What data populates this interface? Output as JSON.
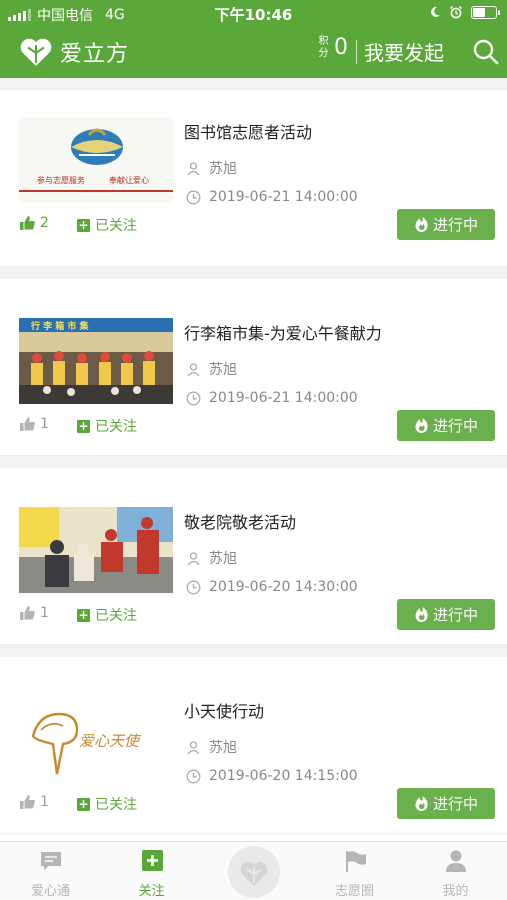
{
  "status_bar": {
    "carrier": "中国电信",
    "network": "4G",
    "time": "下午10:46"
  },
  "header": {
    "app_title": "爱立方",
    "points_label": "积分",
    "points_value": "0",
    "launch_label": "我要发起"
  },
  "activities": [
    {
      "title": "图书馆志愿者活动",
      "author": "苏旭",
      "datetime": "2019-06-21 14:00:00",
      "likes": "2",
      "liked": true,
      "follow_label": "已关注",
      "status": "进行中",
      "image_caption_left": "参与志愿服务",
      "image_caption_right": "奉献让爱心"
    },
    {
      "title": "行李箱市集-为爱心午餐献力",
      "author": "苏旭",
      "datetime": "2019-06-21 14:00:00",
      "likes": "1",
      "liked": false,
      "follow_label": "已关注",
      "status": "进行中",
      "image_banner": "行 李 箱 市 集"
    },
    {
      "title": "敬老院敬老活动",
      "author": "苏旭",
      "datetime": "2019-06-20 14:30:00",
      "likes": "1",
      "liked": false,
      "follow_label": "已关注",
      "status": "进行中"
    },
    {
      "title": "小天使行动",
      "author": "苏旭",
      "datetime": "2019-06-20 14:15:00",
      "likes": "1",
      "liked": false,
      "follow_label": "已关注",
      "status": "进行中",
      "image_logo_text": "爱心天使"
    }
  ],
  "tabbar": {
    "tabs": [
      {
        "label": "爱心通",
        "icon": "chat-icon",
        "active": false
      },
      {
        "label": "关注",
        "icon": "plus-square-icon",
        "active": true
      },
      {
        "label": "志愿圈",
        "icon": "flag-icon",
        "active": false
      },
      {
        "label": "我的",
        "icon": "person-icon",
        "active": false
      }
    ],
    "center_icon": "heart-logo-icon"
  },
  "colors": {
    "brand_green": "#5aa83a",
    "button_green": "#6ab04c",
    "tab_inactive": "#b5b5b5"
  }
}
